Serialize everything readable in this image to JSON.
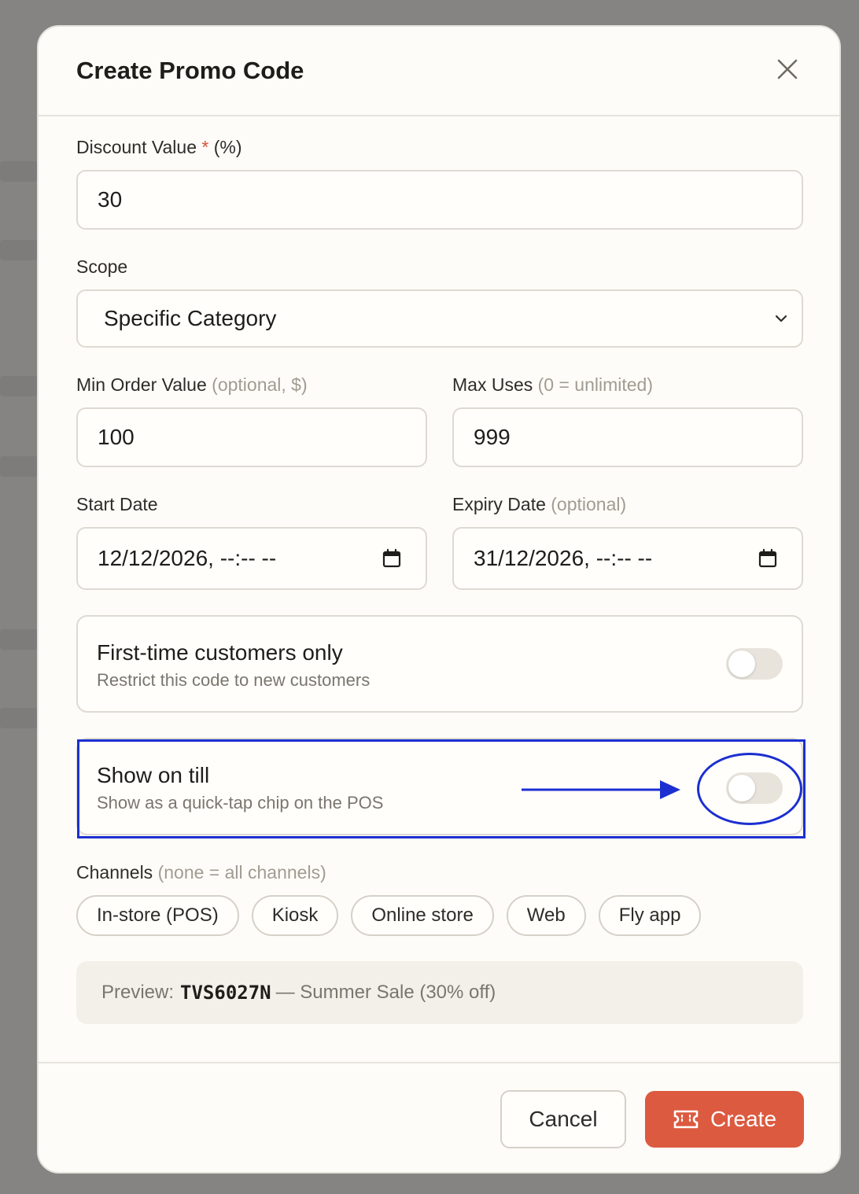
{
  "modal": {
    "title": "Create Promo Code"
  },
  "discount": {
    "label": "Discount Value",
    "required_mark": "*",
    "unit": "(%)",
    "value": "30"
  },
  "scope": {
    "label": "Scope",
    "selected": "Specific Category"
  },
  "min_order": {
    "label": "Min Order Value",
    "hint": "(optional, $)",
    "value": "100"
  },
  "max_uses": {
    "label": "Max Uses",
    "hint": "(0 = unlimited)",
    "value": "999"
  },
  "start_date": {
    "label": "Start Date",
    "value": "12/12/2026, --:-- --"
  },
  "expiry_date": {
    "label": "Expiry Date",
    "hint": "(optional)",
    "value": "31/12/2026, --:-- --"
  },
  "first_time": {
    "title": "First-time customers only",
    "subtitle": "Restrict this code to new customers",
    "enabled": false
  },
  "show_on_till": {
    "title": "Show on till",
    "subtitle": "Show as a quick-tap chip on the POS",
    "enabled": false
  },
  "channels": {
    "label": "Channels",
    "hint": "(none = all channels)",
    "items": [
      {
        "label": "In-store (POS)"
      },
      {
        "label": "Kiosk"
      },
      {
        "label": "Online store"
      },
      {
        "label": "Web"
      },
      {
        "label": "Fly app"
      }
    ]
  },
  "preview": {
    "prefix": "Preview:",
    "code": "TVS6027N",
    "description": "— Summer Sale (30% off)"
  },
  "footer": {
    "cancel_label": "Cancel",
    "create_label": "Create"
  },
  "colors": {
    "accent": "#dc5a40",
    "annotation": "#1c2fd1"
  }
}
